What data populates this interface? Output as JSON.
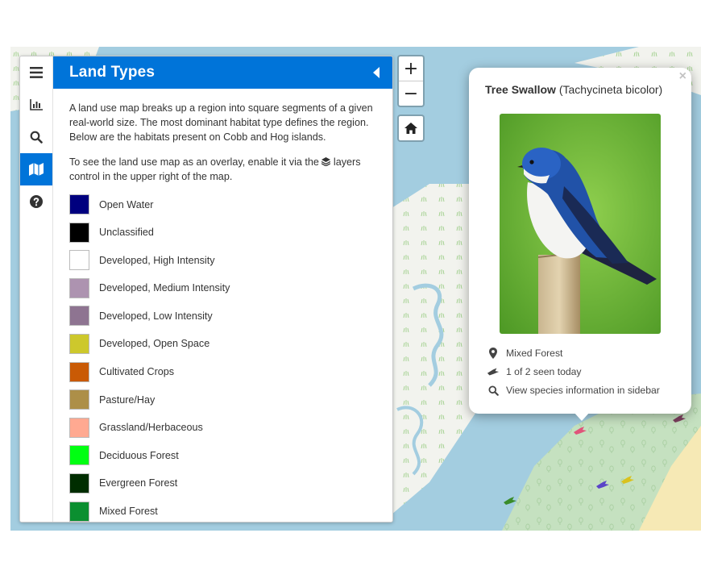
{
  "sidebar": {
    "tabs": [
      {
        "icon": "menu-icon"
      },
      {
        "icon": "bar-chart-icon"
      },
      {
        "icon": "search-icon"
      },
      {
        "icon": "map-icon",
        "active": true
      },
      {
        "icon": "question-circle-icon"
      }
    ],
    "pane": {
      "title": "Land Types",
      "intro": "A land use map breaks up a region into square segments of a given real-world size. The most dominant habitat type defines the region. Below are the habitats present on Cobb and Hog islands.",
      "overlay_text_before": "To see the land use map as an overlay, enable it via the",
      "overlay_text_after": "layers control in the upper right of the map.",
      "legend": [
        {
          "label": "Open Water",
          "color": "#00007f"
        },
        {
          "label": "Unclassified",
          "color": "#000000"
        },
        {
          "label": "Developed, High Intensity",
          "color": "#ffffff"
        },
        {
          "label": "Developed, Medium Intensity",
          "color": "#ad93b0"
        },
        {
          "label": "Developed, Low Intensity",
          "color": "#8e7491"
        },
        {
          "label": "Developed, Open Space",
          "color": "#cdc82c"
        },
        {
          "label": "Cultivated Crops",
          "color": "#c95a05"
        },
        {
          "label": "Pasture/Hay",
          "color": "#ad8f48"
        },
        {
          "label": "Grassland/Herbaceous",
          "color": "#ffa991"
        },
        {
          "label": "Deciduous Forest",
          "color": "#00ff12"
        },
        {
          "label": "Evergreen Forest",
          "color": "#002d00"
        },
        {
          "label": "Mixed Forest",
          "color": "#0b8f30"
        }
      ]
    }
  },
  "map_controls": {
    "zoom_in": "+",
    "zoom_out": "−",
    "home_icon": "home-icon"
  },
  "popup": {
    "close": "×",
    "common_name": "Tree Swallow",
    "scientific_name": "(Tachycineta bicolor)",
    "habitat": "Mixed Forest",
    "sightings": "1 of 2 seen today",
    "link": "View species information in sidebar"
  },
  "colors": {
    "accent": "#0074d9",
    "water": "#a3cde0",
    "land": "#f2f3ee",
    "forest": "#c5e1c0",
    "beach": "#f6e9b5"
  },
  "markers": [
    {
      "color": "#e0547a",
      "species": "bird-icon"
    },
    {
      "color": "#7c3f5e",
      "species": "bird-icon"
    },
    {
      "color": "#5a44c8",
      "species": "bird-icon"
    },
    {
      "color": "#d9c21e",
      "species": "bird-icon"
    },
    {
      "color": "#3a8c2a",
      "species": "bird-icon"
    }
  ]
}
